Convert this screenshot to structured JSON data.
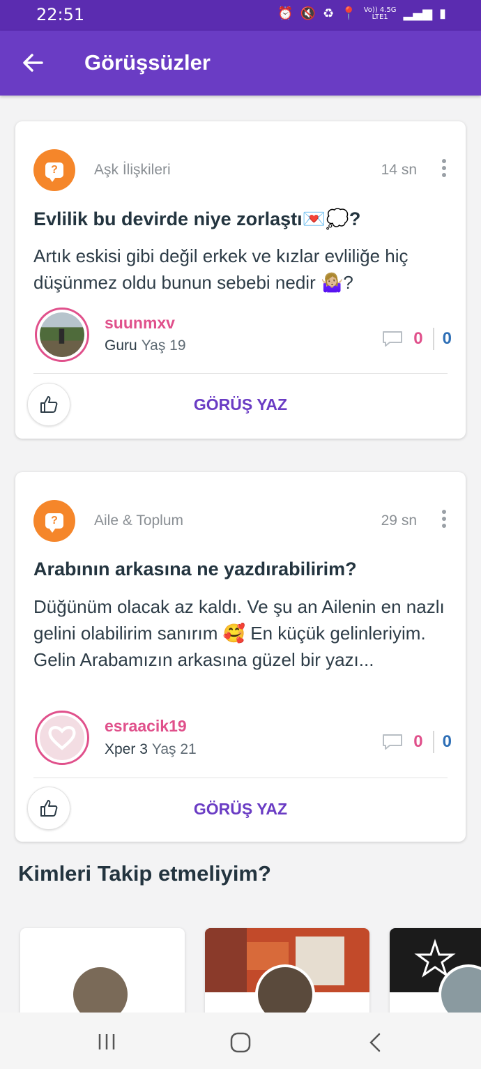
{
  "status_bar": {
    "time": "22:51",
    "network_top": "Vo)) 4.5G",
    "network_bottom": "LTE1"
  },
  "app_bar": {
    "title": "Görüşsüzler",
    "back_icon": "arrow-left-icon"
  },
  "questions": [
    {
      "category": "Aşk İlişkileri",
      "time": "14 sn",
      "title": "Evlilik bu devirde niye zorlaştı💌💭?",
      "body": "Artık eskisi gibi değil erkek ve kızlar evliliğe hiç düşünmez oldu bunun sebebi nedir 🤷🏼‍♀️?",
      "username": "suunmxv",
      "user_level": "Guru",
      "user_age": "Yaş 19",
      "comment_count": "0",
      "other_count": "0",
      "write_label": "GÖRÜŞ YAZ"
    },
    {
      "category": "Aile & Toplum",
      "time": "29 sn",
      "title": "Arabının arkasına ne yazdırabilirim?",
      "body": "Düğünüm olacak az kaldı. Ve şu an Ailenin en nazlı gelini olabilirim sanırım 🥰 En küçük gelinleriyim. Gelin Arabamızın arkasına güzel bir yazı...",
      "username": "esraacik19",
      "user_level": "Xper 3",
      "user_age": "Yaş 21",
      "comment_count": "0",
      "other_count": "0",
      "write_label": "GÖRÜŞ YAZ"
    }
  ],
  "suggestions": {
    "title": "Kimleri Takip etmeliyim?"
  },
  "colors": {
    "primary": "#6a3cc4",
    "accent_pink": "#e0508b",
    "accent_orange": "#f5862a",
    "count_blue": "#2e6fb6"
  }
}
